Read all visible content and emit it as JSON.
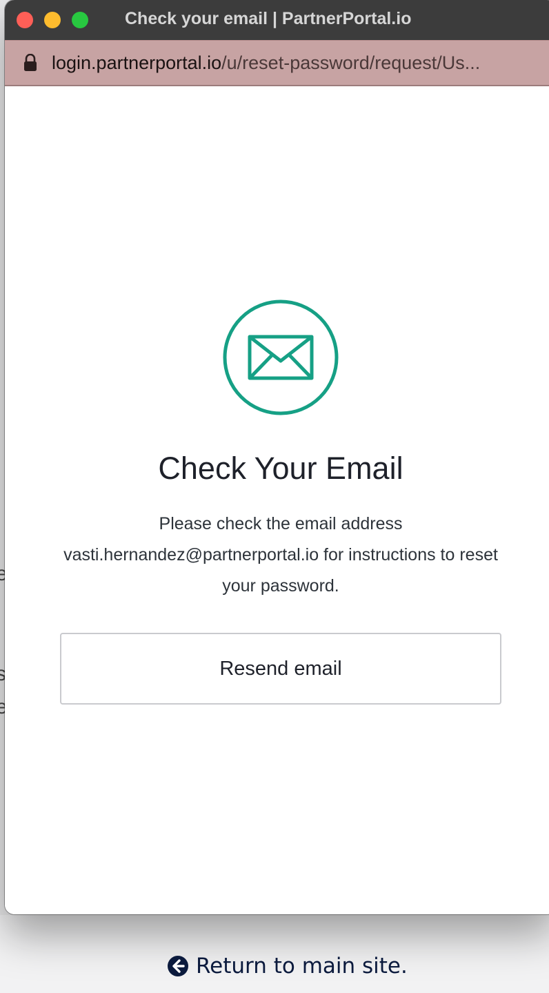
{
  "window": {
    "title": "Check your email | PartnerPortal.io"
  },
  "address_bar": {
    "url_host": "login.partnerportal.io",
    "url_path": "/u/reset-password/request/Us...",
    "lock_icon": "lock-icon"
  },
  "page": {
    "icon": "envelope-icon",
    "heading": "Check Your Email",
    "instructions": "Please check the email address vasti.hernandez@partnerportal.io for instructions to reset your password.",
    "resend_label": "Resend email",
    "accent_color": "#16a085"
  },
  "footer": {
    "return_label": "Return to main site.",
    "return_icon": "arrow-left-circle-icon"
  }
}
